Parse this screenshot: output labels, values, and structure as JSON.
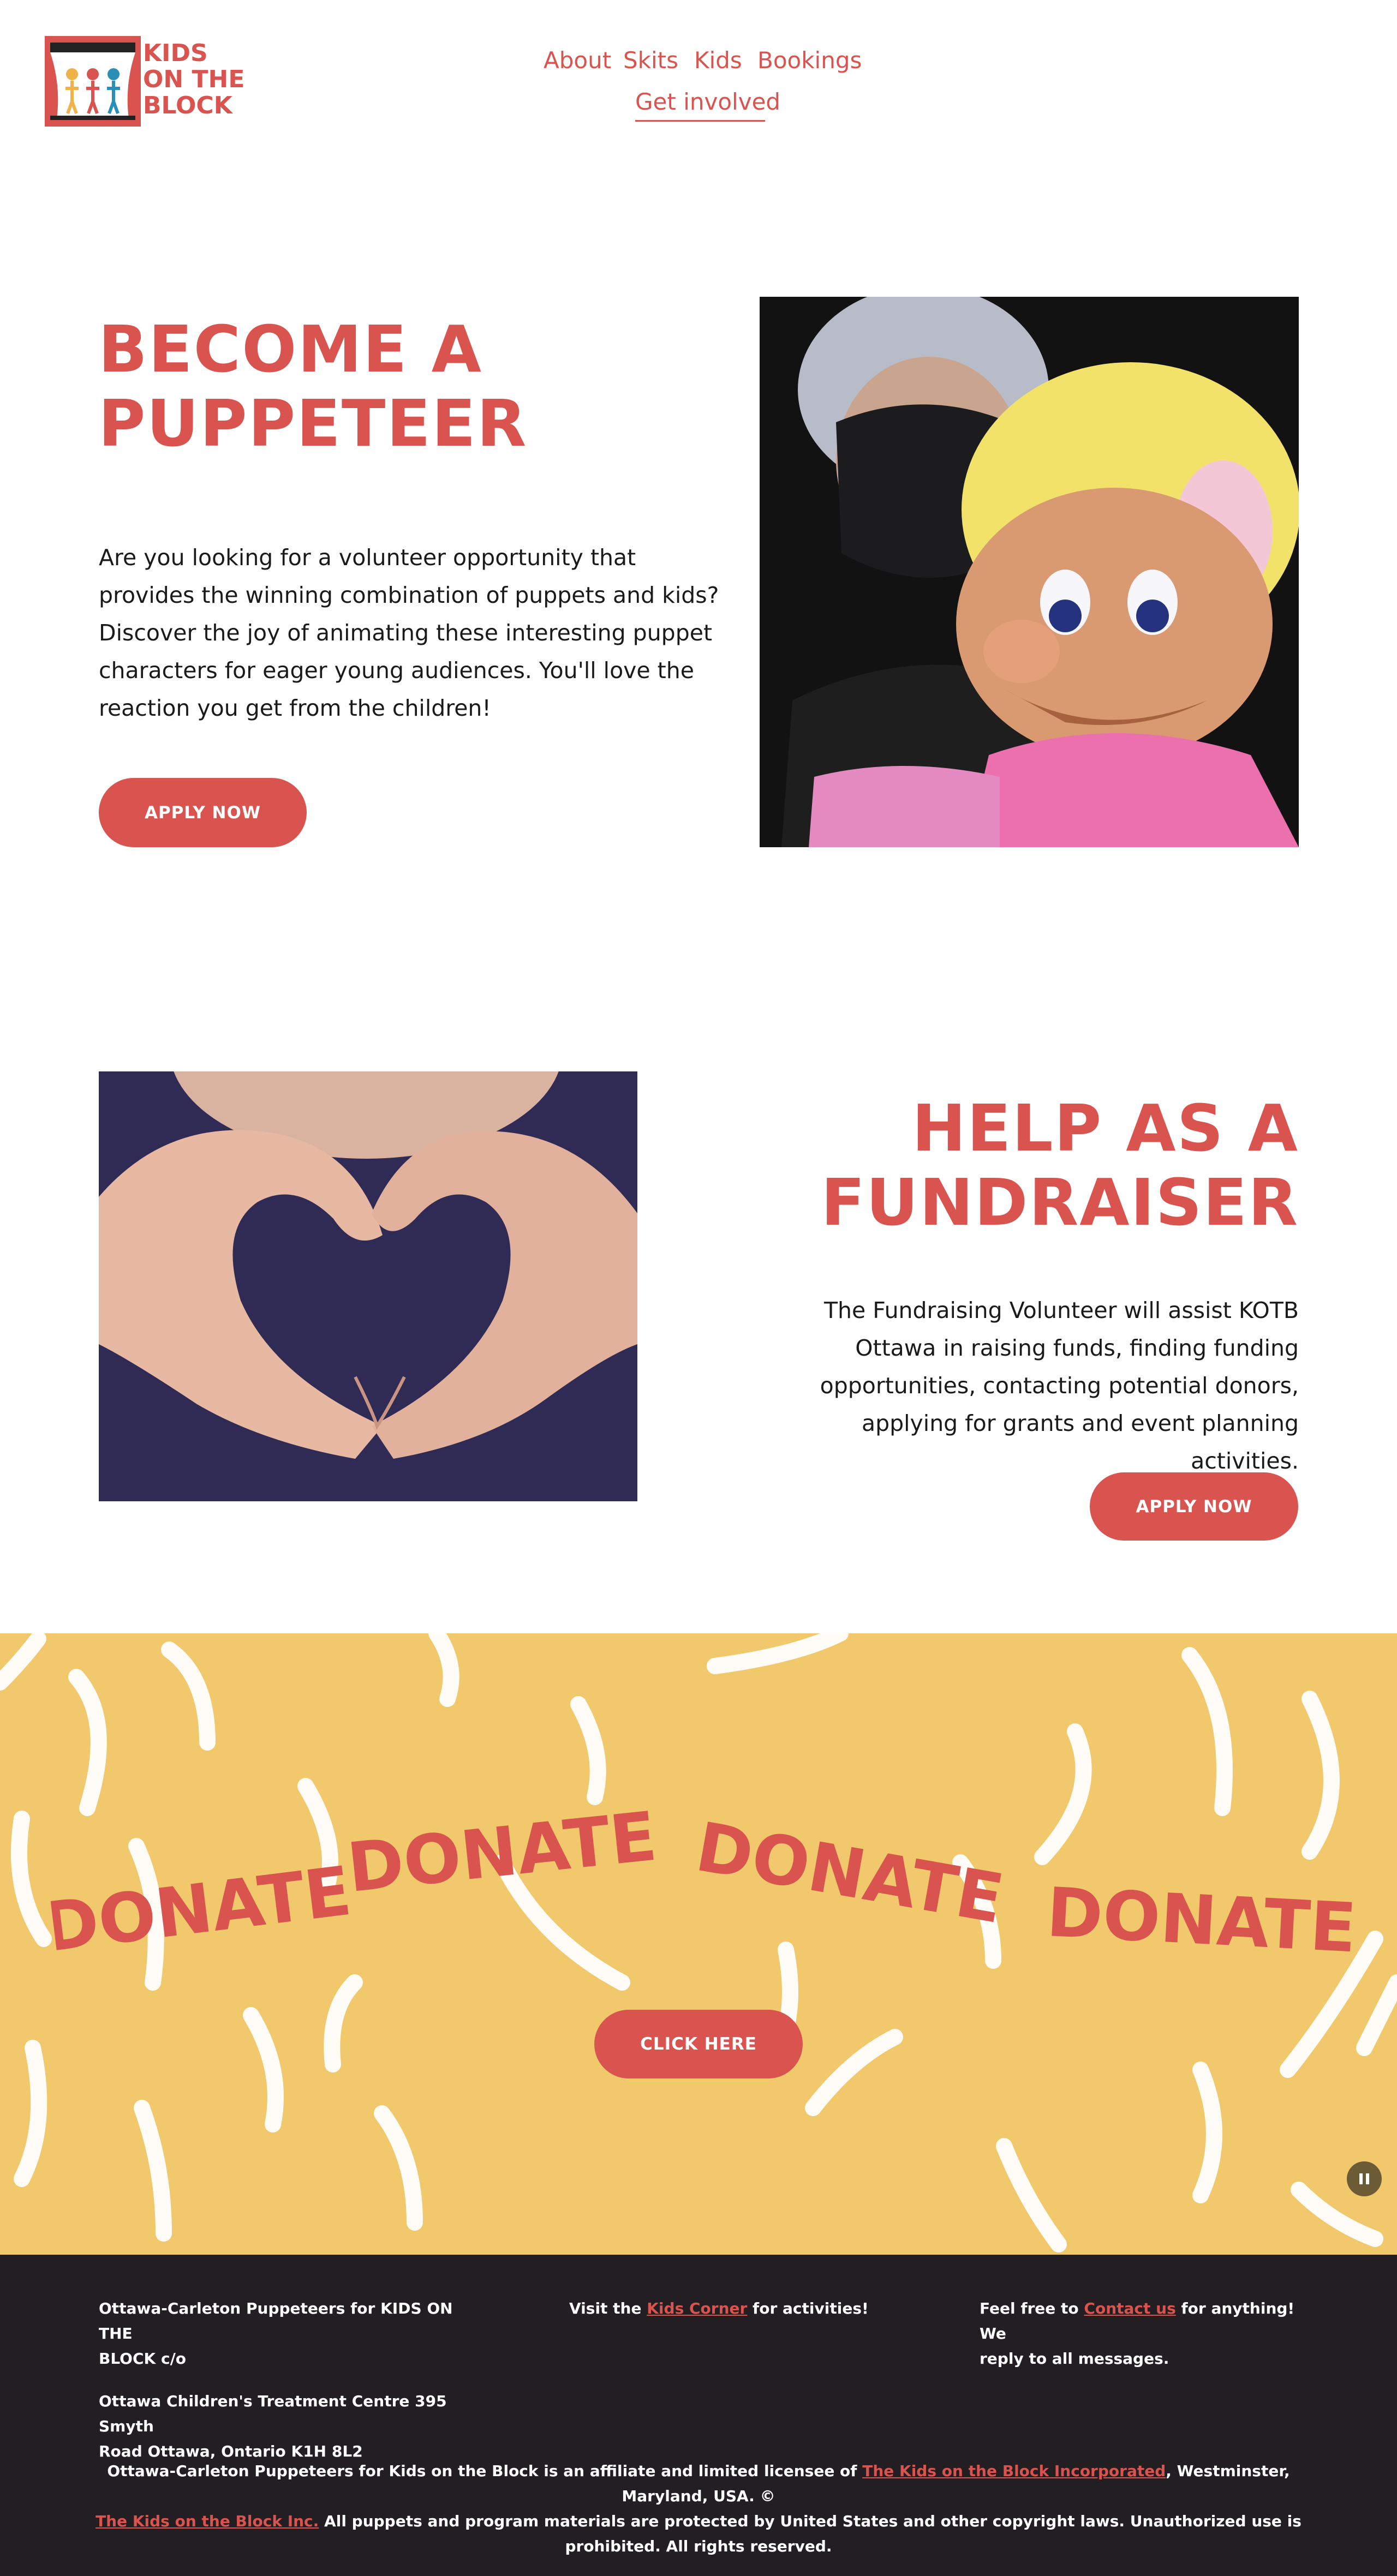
{
  "header": {
    "logo_lines": [
      "KIDS",
      "ON THE",
      "BLOCK"
    ],
    "nav": {
      "about": "About",
      "skits": "Skits",
      "kids": "Kids",
      "bookings": "Bookings",
      "get_involved": "Get involved"
    }
  },
  "puppeteer": {
    "heading_line1": "BECOME A",
    "heading_line2": "PUPPETEER",
    "body_lines": [
      "Are you looking for a volunteer opportunity that",
      "provides the winning combination of puppets and kids?",
      "Discover the joy of animating these interesting puppet",
      "characters for eager young audiences. You'll love the",
      "reaction you get from the children!"
    ],
    "apply_label": "APPLY NOW"
  },
  "fundraiser": {
    "heading_line1": "HELP AS A",
    "heading_line2": "FUNDRAISER",
    "body_lines": [
      "The Fundraising Volunteer will assist KOTB",
      "Ottawa in raising funds, finding funding",
      "opportunities, contacting potential donors,",
      "applying for grants and event planning activities."
    ],
    "apply_label": "APPLY NOW"
  },
  "donate_band": {
    "words": [
      "DONATE",
      "DONATE",
      "DONATE",
      "DONATE"
    ],
    "cta_label": "CLICK HERE"
  },
  "footer": {
    "address_line1": "Ottawa-Carleton Puppeteers for KIDS ON THE",
    "address_line2": "BLOCK c/o",
    "address_line3": "Ottawa Children's Treatment Centre 395 Smyth",
    "address_line4": "Road Ottawa, Ontario K1H 8L2",
    "visit_prefix": "Visit the ",
    "kids_corner_link": "Kids Corner",
    "visit_suffix": " for activities!",
    "contact_prefix": "Feel free to ",
    "contact_link": "Contact us",
    "contact_suffix": " for anything! We",
    "contact_line2": "reply to all messages.",
    "legal_prefix": "Ottawa-Carleton Puppeteers for Kids on the Block is an affiliate and limited licensee of ",
    "legal_link1": "The Kids on the Block Incorporated",
    "legal_mid": ", Westminster, Maryland, USA. ©",
    "legal_link2": "The Kids on the Block Inc.",
    "legal_suffix": " All puppets and program materials are protected by United States and other copyright laws. Unauthorized use is prohibited. All rights reserved."
  },
  "colors": {
    "brand_red": "#d9534f",
    "band_yellow": "#f1c86b",
    "footer_bg": "#221e22"
  }
}
